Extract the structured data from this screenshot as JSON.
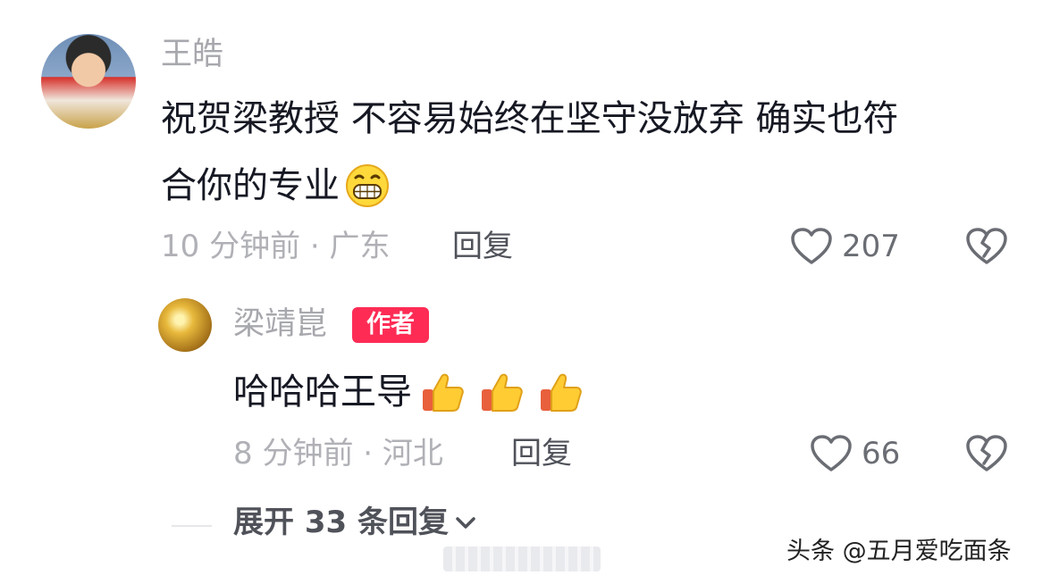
{
  "comment": {
    "username": "王皓",
    "text_line1": "祝贺梁教授 不容易始终在坚守没放弃 确实也符",
    "text_line2": "合你的专业",
    "emoji": "grin-emoji",
    "time_location": "10 分钟前 · 广东",
    "reply_label": "回复",
    "like_count": "207"
  },
  "reply": {
    "username": "梁靖崑",
    "badge": "作者",
    "text": "哈哈哈王导",
    "emojis": [
      "thumbs-up-emoji",
      "thumbs-up-emoji",
      "thumbs-up-emoji"
    ],
    "time_location": "8 分钟前 · 河北",
    "reply_label": "回复",
    "like_count": "66"
  },
  "expand": {
    "label": "展开 33 条回复"
  },
  "watermark": {
    "text": "头条 @五月爱吃面条"
  },
  "colors": {
    "accent": "#fe2c55",
    "text": "#161823",
    "muted": "#a7a8ad"
  }
}
